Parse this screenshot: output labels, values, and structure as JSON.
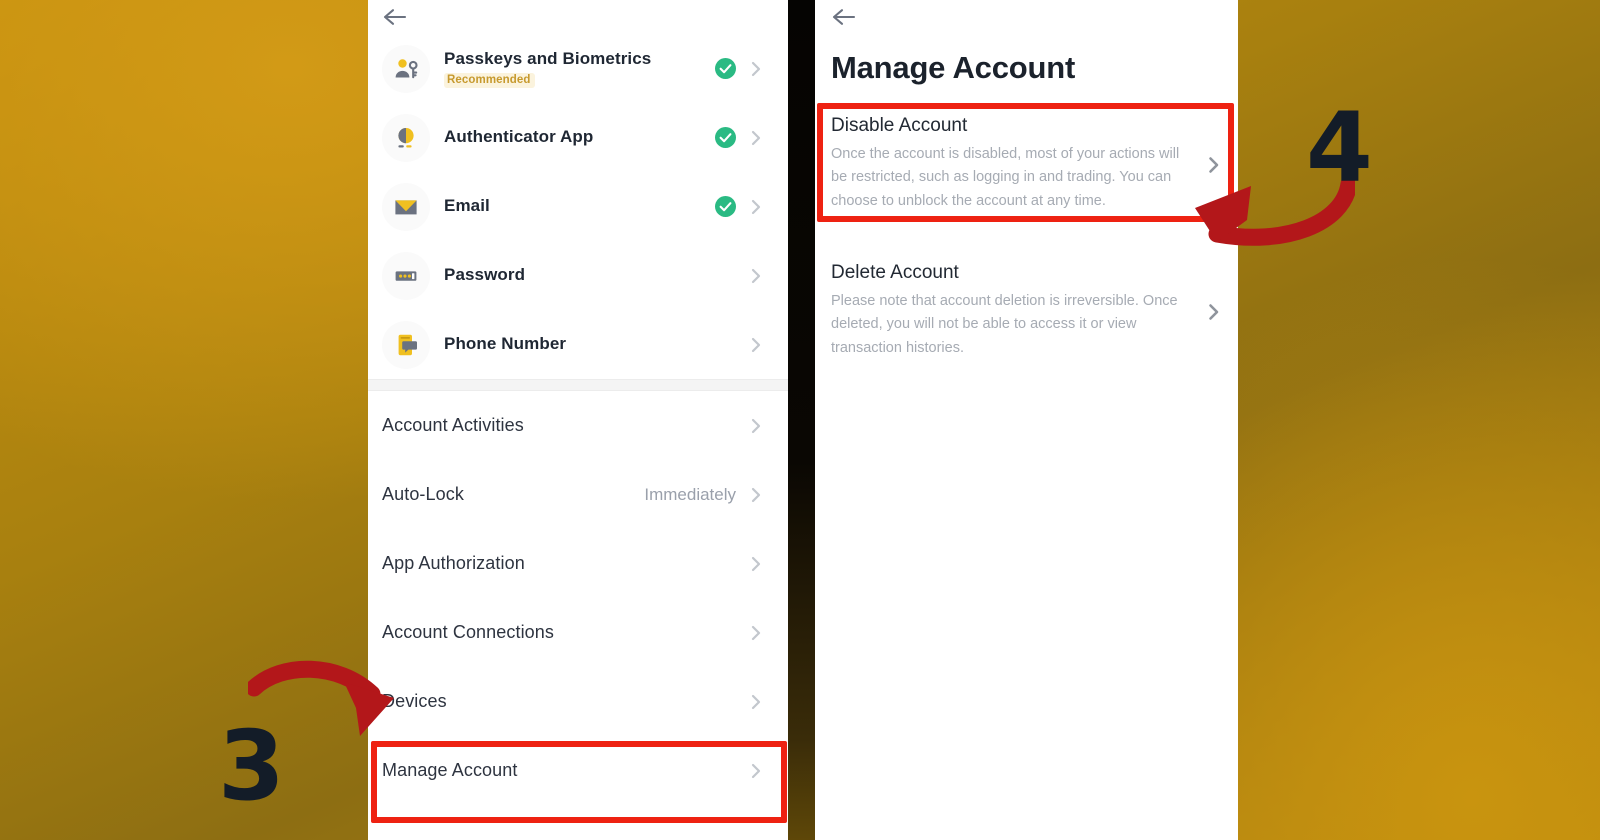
{
  "background": {
    "accent": "#b5870f"
  },
  "annotations": {
    "highlight_color": "#ee2212",
    "steps": [
      {
        "label": "3",
        "target": "Manage Account"
      },
      {
        "label": "4",
        "target": "Disable Account"
      }
    ]
  },
  "left_panel": {
    "back_icon": "back-arrow-icon",
    "security_methods": [
      {
        "icon": "passkey-person-icon",
        "title": "Passkeys and Biometrics",
        "badge": "Recommended",
        "verified": true,
        "chevron": true
      },
      {
        "icon": "authenticator-token-icon",
        "title": "Authenticator App",
        "badge": "",
        "verified": true,
        "chevron": true
      },
      {
        "icon": "envelope-icon",
        "title": "Email",
        "badge": "",
        "verified": true,
        "chevron": true
      },
      {
        "icon": "password-dots-icon",
        "title": "Password",
        "badge": "",
        "verified": false,
        "chevron": true
      },
      {
        "icon": "phone-message-icon",
        "title": "Phone Number",
        "badge": "",
        "verified": false,
        "chevron": true
      }
    ],
    "settings": [
      {
        "title": "Account Activities",
        "value": "",
        "chevron": true
      },
      {
        "title": "Auto-Lock",
        "value": "Immediately",
        "chevron": true
      },
      {
        "title": "App Authorization",
        "value": "",
        "chevron": true
      },
      {
        "title": "Account Connections",
        "value": "",
        "chevron": true
      },
      {
        "title": "Devices",
        "value": "",
        "chevron": true
      },
      {
        "title": "Manage Account",
        "value": "",
        "chevron": true
      }
    ]
  },
  "right_panel": {
    "back_icon": "back-arrow-icon",
    "title": "Manage Account",
    "options": [
      {
        "title": "Disable Account",
        "description": "Once the account is disabled, most of your actions will be restricted, such as logging in and trading. You can choose to unblock the account at any time.",
        "chevron": true
      },
      {
        "title": "Delete Account",
        "description": "Please note that account deletion is irreversible. Once deleted, you will not be able to access it or view transaction histories.",
        "chevron": true
      }
    ]
  }
}
